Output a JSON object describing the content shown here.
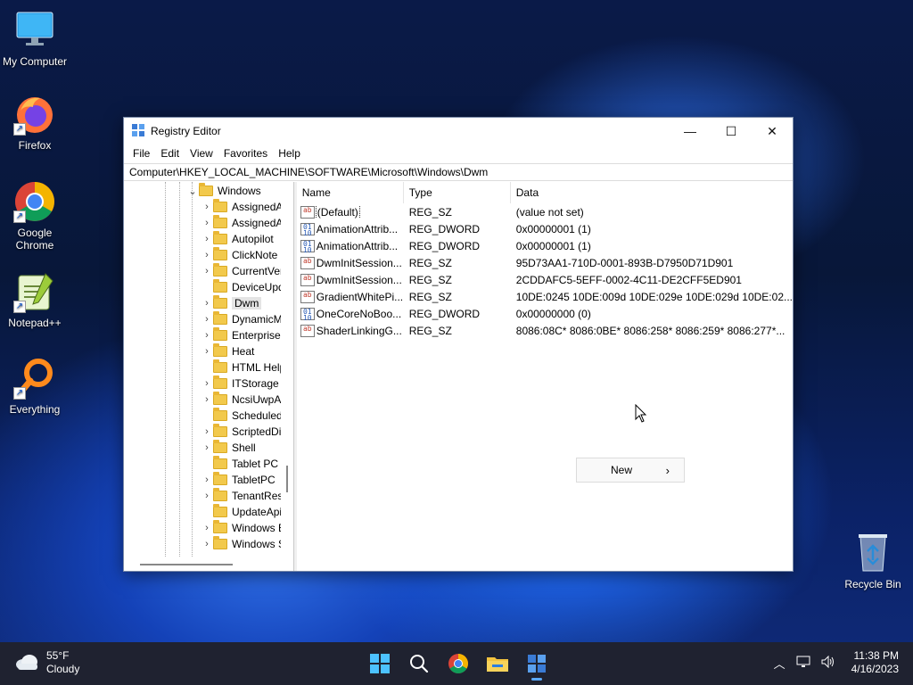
{
  "desktop": {
    "icons": [
      {
        "label": "My Computer",
        "icon": "monitor-icon"
      },
      {
        "label": "Firefox",
        "icon": "firefox-icon"
      },
      {
        "label": "Google Chrome",
        "icon": "chrome-icon"
      },
      {
        "label": "Notepad++",
        "icon": "notepadpp-icon"
      },
      {
        "label": "Everything",
        "icon": "everything-search-icon"
      },
      {
        "label": "Recycle Bin",
        "icon": "recycle-bin-icon"
      }
    ]
  },
  "window": {
    "title": "Registry Editor",
    "controls": {
      "minimize": "—",
      "maximize": "☐",
      "close": "✕"
    },
    "menu": [
      "File",
      "Edit",
      "View",
      "Favorites",
      "Help"
    ],
    "address": "Computer\\HKEY_LOCAL_MACHINE\\SOFTWARE\\Microsoft\\Windows\\Dwm",
    "tree": {
      "parent": "Windows",
      "children": [
        {
          "label": "AssignedAcce",
          "expandable": true
        },
        {
          "label": "AssignedAcce",
          "expandable": true
        },
        {
          "label": "Autopilot",
          "expandable": true
        },
        {
          "label": "ClickNote",
          "expandable": true
        },
        {
          "label": "CurrentVersion",
          "expandable": true
        },
        {
          "label": "DeviceUpdate",
          "expandable": false
        },
        {
          "label": "Dwm",
          "expandable": true,
          "selected": true
        },
        {
          "label": "DynamicMana",
          "expandable": true
        },
        {
          "label": "EnterpriseResc",
          "expandable": true
        },
        {
          "label": "Heat",
          "expandable": true
        },
        {
          "label": "HTML Help",
          "expandable": false
        },
        {
          "label": "ITStorage",
          "expandable": true
        },
        {
          "label": "NcsiUwpApp",
          "expandable": true
        },
        {
          "label": "ScheduledDiag",
          "expandable": false
        },
        {
          "label": "ScriptedDiagn",
          "expandable": true
        },
        {
          "label": "Shell",
          "expandable": true
        },
        {
          "label": "Tablet PC",
          "expandable": false
        },
        {
          "label": "TabletPC",
          "expandable": true
        },
        {
          "label": "TenantRestrict",
          "expandable": true
        },
        {
          "label": "UpdateApi",
          "expandable": false
        },
        {
          "label": "Windows Error",
          "expandable": true
        },
        {
          "label": "Windows Sear",
          "expandable": true
        }
      ]
    },
    "columns": {
      "name": "Name",
      "type": "Type",
      "data": "Data"
    },
    "values": [
      {
        "name": "(Default)",
        "type": "REG_SZ",
        "data": "(value not set)",
        "kind": "sz"
      },
      {
        "name": "AnimationAttrib...",
        "type": "REG_DWORD",
        "data": "0x00000001 (1)",
        "kind": "dw"
      },
      {
        "name": "AnimationAttrib...",
        "type": "REG_DWORD",
        "data": "0x00000001 (1)",
        "kind": "dw"
      },
      {
        "name": "DwmInitSession...",
        "type": "REG_SZ",
        "data": "95D73AA1-710D-0001-893B-D7950D71D901",
        "kind": "sz"
      },
      {
        "name": "DwmInitSession...",
        "type": "REG_SZ",
        "data": "2CDDAFC5-5EFF-0002-4C11-DE2CFF5ED901",
        "kind": "sz"
      },
      {
        "name": "GradientWhitePi...",
        "type": "REG_SZ",
        "data": "10DE:0245 10DE:009d 10DE:029e 10DE:029d 10DE:02...",
        "kind": "sz"
      },
      {
        "name": "OneCoreNoBoo...",
        "type": "REG_DWORD",
        "data": "0x00000000 (0)",
        "kind": "dw"
      },
      {
        "name": "ShaderLinkingG...",
        "type": "REG_SZ",
        "data": "8086:08C* 8086:0BE* 8086:258* 8086:259* 8086:277*...",
        "kind": "sz"
      }
    ],
    "context_menu": {
      "label": "New",
      "arrow": "›"
    }
  },
  "taskbar": {
    "weather": {
      "temp": "55°F",
      "condition": "Cloudy"
    },
    "apps": [
      "start-icon",
      "search-icon",
      "chrome-icon",
      "file-explorer-icon",
      "registry-editor-icon"
    ],
    "clock": {
      "time": "11:38 PM",
      "date": "4/16/2023"
    }
  }
}
